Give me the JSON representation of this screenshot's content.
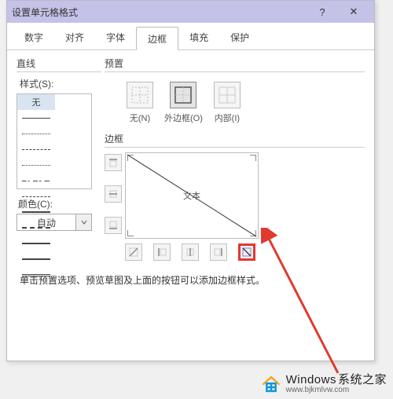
{
  "window": {
    "title": "设置单元格格式",
    "help": "?",
    "close": "✕"
  },
  "tabs": {
    "items": [
      "数字",
      "对齐",
      "字体",
      "边框",
      "填充",
      "保护"
    ],
    "active_index": 3
  },
  "left": {
    "line_section": "直线",
    "style_label": "样式(S):",
    "none_label": "无",
    "color_label": "颜色(C):",
    "color_auto": "自动"
  },
  "right": {
    "preset_section": "预置",
    "presets": {
      "none": "无(N)",
      "outline": "外边框(O)",
      "inside": "内部(I)"
    },
    "border_section": "边框",
    "preview_text": "文本"
  },
  "instruction": "单击预置选项、预览草图及上面的按钮可以添加边框样式。",
  "watermark": {
    "brand": "Windows",
    "suffix": "系统之家",
    "url": "www.bjkmlvw.com"
  }
}
